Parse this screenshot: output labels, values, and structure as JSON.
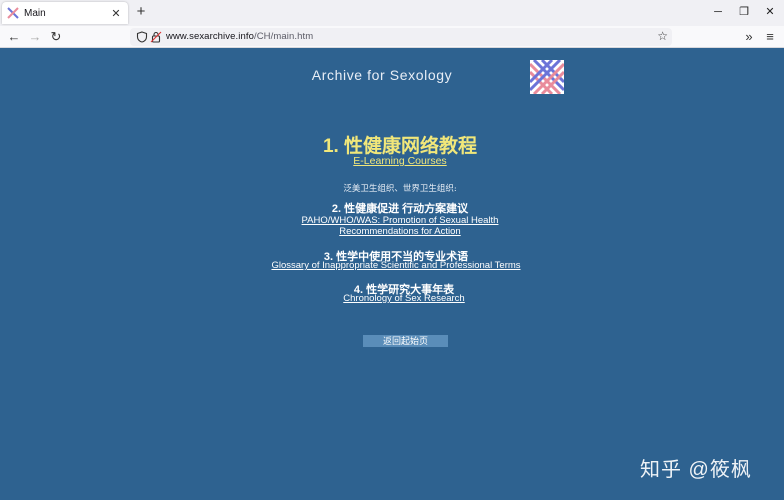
{
  "browser": {
    "tab_title": "Main",
    "tab_close": "✕",
    "new_tab": "+",
    "minimize": "─",
    "restore": "❐",
    "close": "✕",
    "back": "←",
    "forward": "→",
    "reload": "↻",
    "url_domain": "www.sexarchive.info",
    "url_path": "/CH/main.htm",
    "bookmark": "☆",
    "overflow": "»",
    "menu": "≡"
  },
  "page": {
    "site_title": "Archive for Sexology",
    "heading": "1. 性健康网络教程",
    "heading_link": "E-Learning Courses",
    "org_note": "泛美卫生组织、世界卫生组织:",
    "sections": [
      {
        "title": "2. 性健康促进  行动方案建议",
        "link_lines": [
          "PAHO/WHO/WAS: Promotion of Sexual Health",
          "Recommendations for Action"
        ]
      },
      {
        "title": "3. 性学中使用不当的专业术语",
        "link_lines": [
          "Glossary of Inappropriate Scientific and Professional Terms"
        ]
      },
      {
        "title": "4. 性学研究大事年表",
        "link_lines": [
          "Chronology of Sex Research"
        ]
      }
    ],
    "home_button": "返回起始页"
  },
  "watermark": "知乎 @筱枫",
  "colors": {
    "page_bg": "#2e6290",
    "heading_yellow": "#f1e77a",
    "button_bg": "#5a8db9"
  },
  "icons": {
    "favicon": "archive-x-logo",
    "tracking": "shield-icon",
    "lock": "lock-icon",
    "bookmark": "star-icon"
  }
}
